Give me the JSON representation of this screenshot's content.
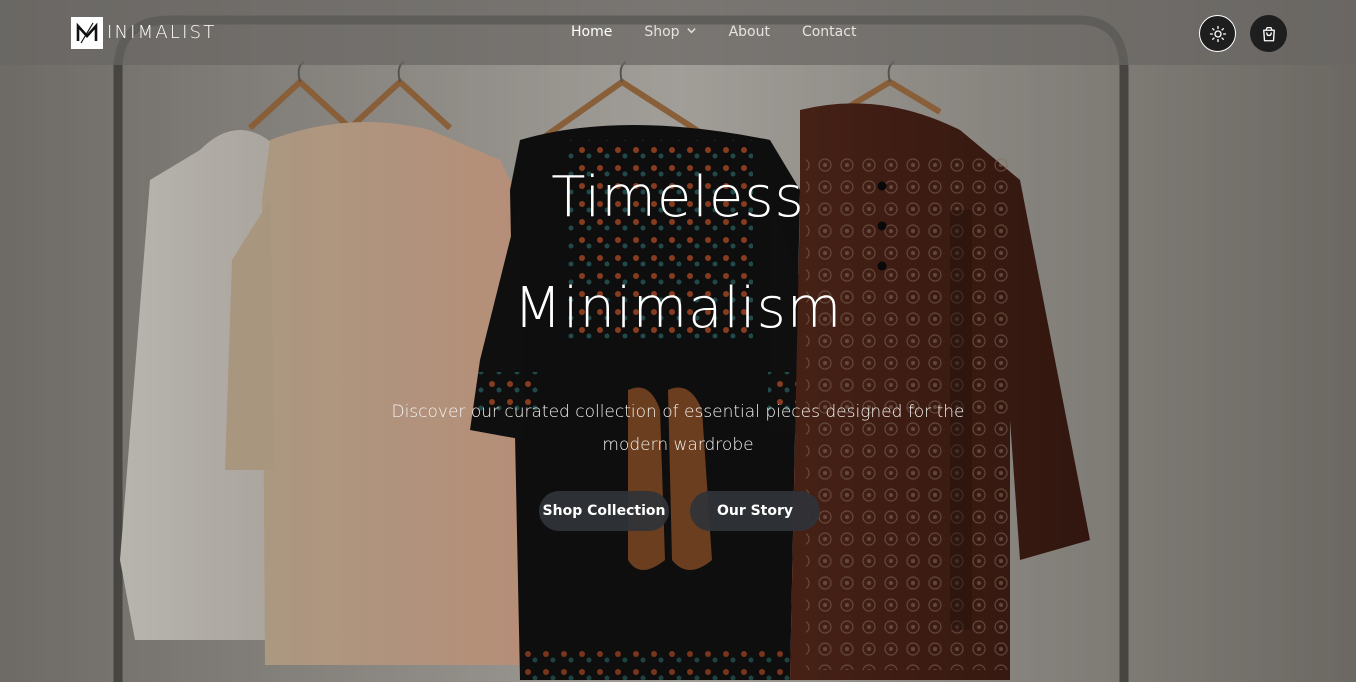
{
  "brand": {
    "logo_letter": "M",
    "name_rest": "INIMALIST"
  },
  "nav": {
    "items": [
      {
        "label": "Home",
        "active": true
      },
      {
        "label": "Shop",
        "has_dropdown": true
      },
      {
        "label": "About"
      },
      {
        "label": "Contact"
      }
    ]
  },
  "header_icons": [
    "sun-icon",
    "shopping-bag-icon"
  ],
  "hero": {
    "headline_line1": "Timeless",
    "headline_line2": "Minimalism",
    "subtitle": "Discover our curated collection of essential pieces designed for the modern wardrobe",
    "primary_button": "Shop Collection",
    "secondary_button": "Our Story"
  },
  "colors": {
    "nav_bg": "#696764",
    "button_bg": "#303338",
    "text": "#ffffff"
  }
}
